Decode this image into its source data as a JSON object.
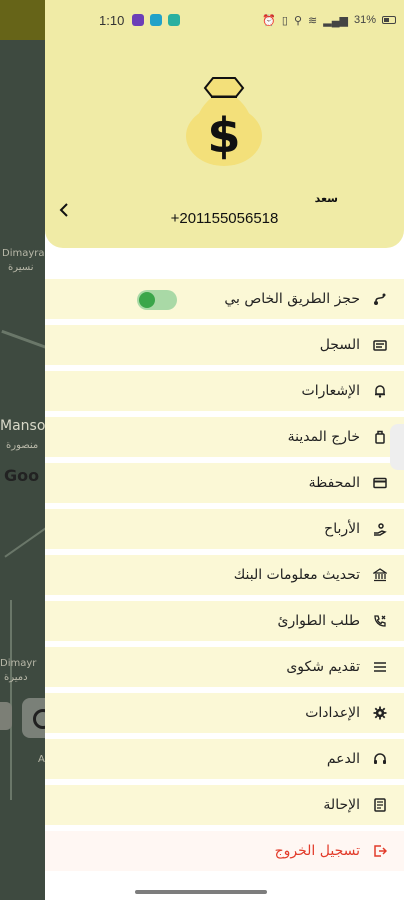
{
  "status_bar": {
    "time": "1:10",
    "battery_text": "31%"
  },
  "background_map": {
    "labels": [
      "Dimayra",
      "نسيرة",
      "Manso",
      "منصورة",
      "Goo",
      "Dimayr",
      "دميرة",
      "A"
    ]
  },
  "header": {
    "user_name": "سعد",
    "phone": "+201155056518",
    "icon": "money-bag-dollar-icon"
  },
  "menu": {
    "items": [
      {
        "label": "حجز الطريق الخاص بي",
        "icon": "route-icon",
        "toggle": true
      },
      {
        "label": "السجل",
        "icon": "history-icon"
      },
      {
        "label": "الإشعارات",
        "icon": "bell-icon"
      },
      {
        "label": "خارج المدينة",
        "icon": "luggage-icon"
      },
      {
        "label": "المحفظة",
        "icon": "wallet-card-icon"
      },
      {
        "label": "الأرباح",
        "icon": "earnings-icon"
      },
      {
        "label": "تحديث معلومات البنك",
        "icon": "bank-icon"
      },
      {
        "label": "طلب الطوارئ",
        "icon": "emergency-phone-icon"
      },
      {
        "label": "تقديم شكوى",
        "icon": "complaint-list-icon"
      },
      {
        "label": "الإعدادات",
        "icon": "gear-icon"
      },
      {
        "label": "الدعم",
        "icon": "headset-icon"
      },
      {
        "label": "الإحالة",
        "icon": "referral-icon"
      },
      {
        "label": "تسجيل الخروج",
        "icon": "logout-icon",
        "style": "danger"
      }
    ]
  },
  "colors": {
    "header_bg": "#f0eba6",
    "item_bg": "#fbf8d6",
    "logout": "#e23b2a",
    "toggle_on": "#3aa64a"
  }
}
